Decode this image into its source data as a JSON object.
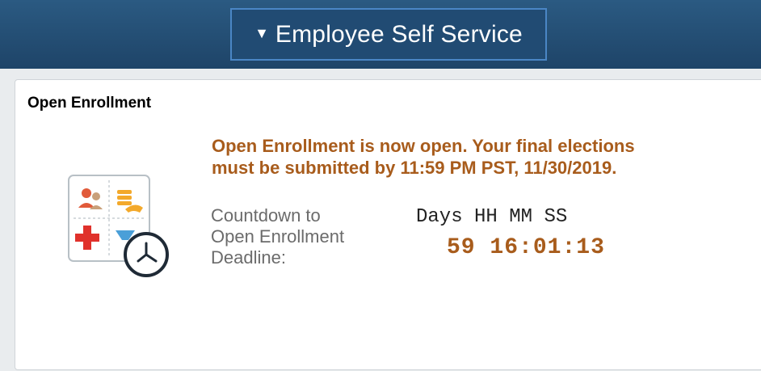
{
  "header": {
    "page_selector_label": "Employee Self Service",
    "caret_glyph": "▼"
  },
  "tile": {
    "title": "Open Enrollment",
    "notice_line1": "Open Enrollment is now open. Your final elections",
    "notice_line2": "must be submitted by 11:59 PM PST, 11/30/2019.",
    "countdown_label_line1": "Countdown to",
    "countdown_label_line2": "Open Enrollment",
    "countdown_label_line3": "Deadline:",
    "countdown_headers": {
      "days": "Days",
      "hh": "HH",
      "mm": "MM",
      "ss": "SS"
    },
    "countdown_values": {
      "days": "59",
      "hh": "16",
      "mm": "01",
      "ss": "13"
    },
    "icon": "benefits-clock-icon"
  },
  "colors": {
    "header_bg": "#1e4468",
    "accent_orange": "#a85c1c",
    "selector_border": "#4a86c5"
  }
}
